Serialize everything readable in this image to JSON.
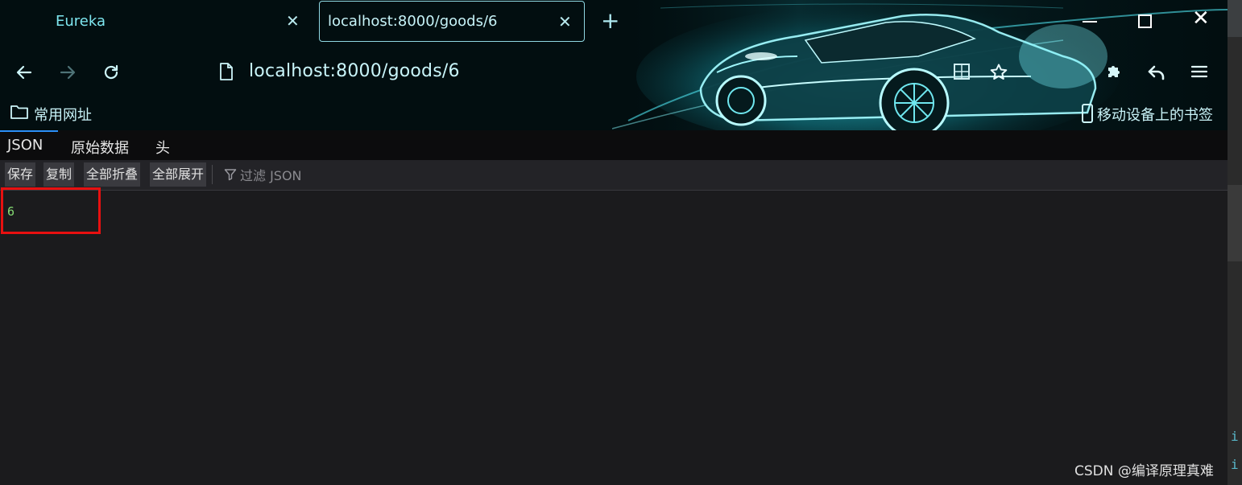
{
  "browser": {
    "tabs": [
      {
        "title": "Eureka",
        "active": false
      },
      {
        "title": "localhost:8000/goods/6",
        "active": true
      }
    ],
    "url": "localhost:8000/goods/6",
    "bookmarks": {
      "left_label": "常用网址",
      "right_label": "移动设备上的书签"
    },
    "icons": {
      "back": "back-arrow-icon",
      "forward": "forward-arrow-icon",
      "reload": "reload-icon",
      "page": "page-icon",
      "star": "star-icon",
      "extension": "extension-icon",
      "undo": "undo-icon",
      "menu": "hamburger-menu-icon"
    },
    "accent": "#7ee6ef"
  },
  "json_viewer": {
    "tabs": [
      "JSON",
      "原始数据",
      "头"
    ],
    "active_tab": "JSON",
    "toolbar": {
      "save": "保存",
      "copy": "复制",
      "collapse_all": "全部折叠",
      "expand_all": "全部展开",
      "filter_placeholder": "过滤 JSON"
    },
    "value": "6",
    "value_color": "#86de74",
    "highlight_color": "#e81010"
  },
  "side_window": {
    "glyphs": [
      "i",
      "i"
    ]
  },
  "watermark": "CSDN @编译原理真难"
}
